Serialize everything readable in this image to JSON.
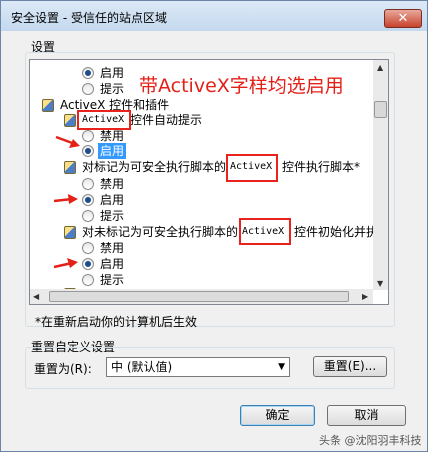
{
  "window": {
    "title": "安全设置 - 受信任的站点区域",
    "close_label": "✕"
  },
  "settings": {
    "group_label": "设置",
    "partial_item_label": "...",
    "items": [
      {
        "type": "radio",
        "label": "启用",
        "checked": true
      },
      {
        "type": "radio",
        "label": "提示",
        "checked": false
      },
      {
        "type": "category",
        "label": "ActiveX 控件和插件"
      },
      {
        "type": "setting",
        "prefix": "",
        "keyword": "ActiveX",
        "suffix": "控件自动提示"
      },
      {
        "type": "radio",
        "label": "禁用",
        "checked": false
      },
      {
        "type": "radio",
        "label": "启用",
        "checked": true,
        "selected": true
      },
      {
        "type": "setting",
        "prefix": "对标记为可安全执行脚本的",
        "keyword": "ActiveX",
        "suffix": "控件执行脚本*"
      },
      {
        "type": "radio",
        "label": "禁用",
        "checked": false
      },
      {
        "type": "radio",
        "label": "启用",
        "checked": true
      },
      {
        "type": "radio",
        "label": "提示",
        "checked": false
      },
      {
        "type": "setting",
        "prefix": "对未标记为可安全执行脚本的",
        "keyword": "ActiveX",
        "suffix": "控件初始化并执"
      },
      {
        "type": "radio",
        "label": "禁用",
        "checked": false
      },
      {
        "type": "radio",
        "label": "启用",
        "checked": true
      },
      {
        "type": "radio",
        "label": "提示",
        "checked": false
      }
    ]
  },
  "annotation": "带ActiveX字样均选启用",
  "restart_note": "*在重新启动你的计算机后生效",
  "reset": {
    "group_label": "重置自定义设置",
    "reset_to_label": "重置为(R):",
    "selected_level": "中 (默认值)",
    "reset_button": "重置(E)..."
  },
  "buttons": {
    "ok": "确定",
    "cancel": "取消"
  },
  "watermark": "头条 @沈阳羽丰科技",
  "colors": {
    "annotation": "#e32119",
    "selection": "#3399ff"
  }
}
